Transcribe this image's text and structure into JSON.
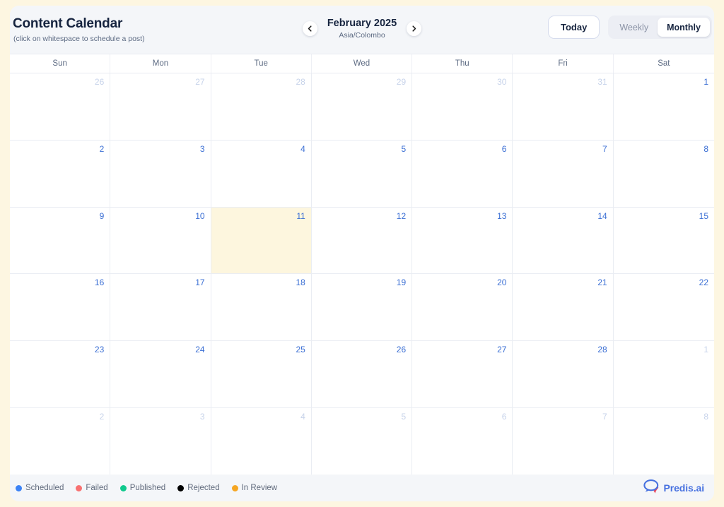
{
  "header": {
    "title": "Content Calendar",
    "subtitle": "(click on whitespace to schedule a post)",
    "prev_icon": "chevron-left-icon",
    "next_icon": "chevron-right-icon",
    "month_label": "February 2025",
    "timezone": "Asia/Colombo",
    "today_label": "Today",
    "view_options": [
      {
        "label": "Weekly",
        "active": false
      },
      {
        "label": "Monthly",
        "active": true
      }
    ]
  },
  "calendar": {
    "weekdays": [
      "Sun",
      "Mon",
      "Tue",
      "Wed",
      "Thu",
      "Fri",
      "Sat"
    ],
    "today": {
      "date": 11,
      "weekday": "Tue"
    },
    "weeks": [
      [
        {
          "num": "26",
          "in_month": false
        },
        {
          "num": "27",
          "in_month": false
        },
        {
          "num": "28",
          "in_month": false
        },
        {
          "num": "29",
          "in_month": false
        },
        {
          "num": "30",
          "in_month": false
        },
        {
          "num": "31",
          "in_month": false
        },
        {
          "num": "1",
          "in_month": true
        }
      ],
      [
        {
          "num": "2",
          "in_month": true
        },
        {
          "num": "3",
          "in_month": true
        },
        {
          "num": "4",
          "in_month": true
        },
        {
          "num": "5",
          "in_month": true
        },
        {
          "num": "6",
          "in_month": true
        },
        {
          "num": "7",
          "in_month": true
        },
        {
          "num": "8",
          "in_month": true
        }
      ],
      [
        {
          "num": "9",
          "in_month": true
        },
        {
          "num": "10",
          "in_month": true
        },
        {
          "num": "11",
          "in_month": true,
          "today": true
        },
        {
          "num": "12",
          "in_month": true
        },
        {
          "num": "13",
          "in_month": true
        },
        {
          "num": "14",
          "in_month": true
        },
        {
          "num": "15",
          "in_month": true
        }
      ],
      [
        {
          "num": "16",
          "in_month": true
        },
        {
          "num": "17",
          "in_month": true
        },
        {
          "num": "18",
          "in_month": true
        },
        {
          "num": "19",
          "in_month": true
        },
        {
          "num": "20",
          "in_month": true
        },
        {
          "num": "21",
          "in_month": true
        },
        {
          "num": "22",
          "in_month": true
        }
      ],
      [
        {
          "num": "23",
          "in_month": true
        },
        {
          "num": "24",
          "in_month": true
        },
        {
          "num": "25",
          "in_month": true
        },
        {
          "num": "26",
          "in_month": true
        },
        {
          "num": "27",
          "in_month": true
        },
        {
          "num": "28",
          "in_month": true
        },
        {
          "num": "1",
          "in_month": false
        }
      ],
      [
        {
          "num": "2",
          "in_month": false
        },
        {
          "num": "3",
          "in_month": false
        },
        {
          "num": "4",
          "in_month": false
        },
        {
          "num": "5",
          "in_month": false
        },
        {
          "num": "6",
          "in_month": false
        },
        {
          "num": "7",
          "in_month": false
        },
        {
          "num": "8",
          "in_month": false
        }
      ]
    ]
  },
  "footer": {
    "legend": [
      {
        "label": "Scheduled",
        "color": "#3b82f6"
      },
      {
        "label": "Failed",
        "color": "#f87171"
      },
      {
        "label": "Published",
        "color": "#10c98d"
      },
      {
        "label": "Rejected",
        "color": "#000000"
      },
      {
        "label": "In Review",
        "color": "#f5a623"
      }
    ],
    "brand": {
      "name": "Predis.ai",
      "logo_icon": "speech-bubble-logo-icon",
      "bubble_color": "#4771e0",
      "swoosh_color": "#e8465e"
    }
  },
  "colors": {
    "page_background": "#fdf6e1",
    "card_background": "#f4f6f9",
    "grid_background": "#ffffff",
    "today_highlight": "#fdf6de",
    "in_month_date": "#3b6fd4",
    "out_month_date": "#c7d3ea",
    "title_text": "#16243f"
  }
}
